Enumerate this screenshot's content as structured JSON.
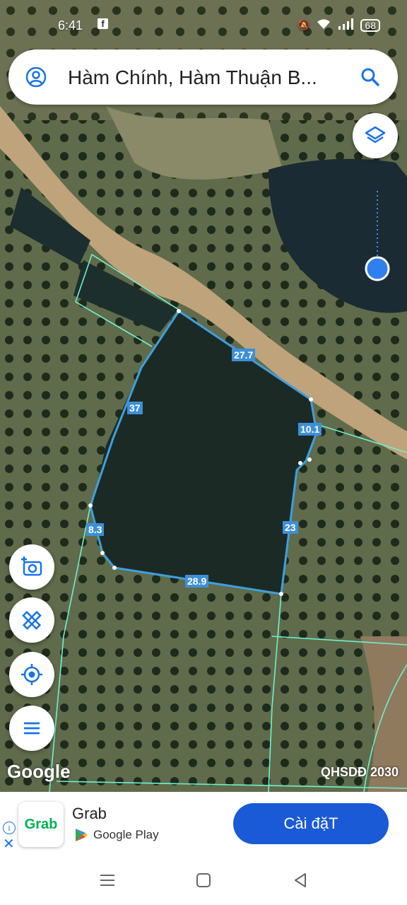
{
  "status_bar": {
    "time": "6:41",
    "fb_icon": "f",
    "battery": "68"
  },
  "search": {
    "query": "Hàm Chính, Hàm Thuận B...",
    "account_icon": "account-circle-icon",
    "search_icon": "search-icon"
  },
  "map": {
    "layers_icon": "layers-icon",
    "parcel_measurements": [
      "27.7",
      "10.1",
      "23",
      "28.9",
      "8.3",
      "37"
    ],
    "watermark": "Google",
    "plan_label": "QHSDĐ 2030"
  },
  "tools": [
    {
      "name": "camera-add",
      "icon": "camera-add-icon"
    },
    {
      "name": "measure",
      "icon": "ruler-pencil-icon"
    },
    {
      "name": "my-location",
      "icon": "crosshair-icon"
    },
    {
      "name": "menu",
      "icon": "menu-icon"
    }
  ],
  "ad": {
    "app_icon_text": "Grab",
    "title": "Grab",
    "store": "Google Play",
    "install": "Cài đặT",
    "accent": "#1a5ad7"
  },
  "nav": {
    "menu_icon": "recent-apps-icon",
    "home_icon": "home-icon",
    "back_icon": "back-icon"
  }
}
